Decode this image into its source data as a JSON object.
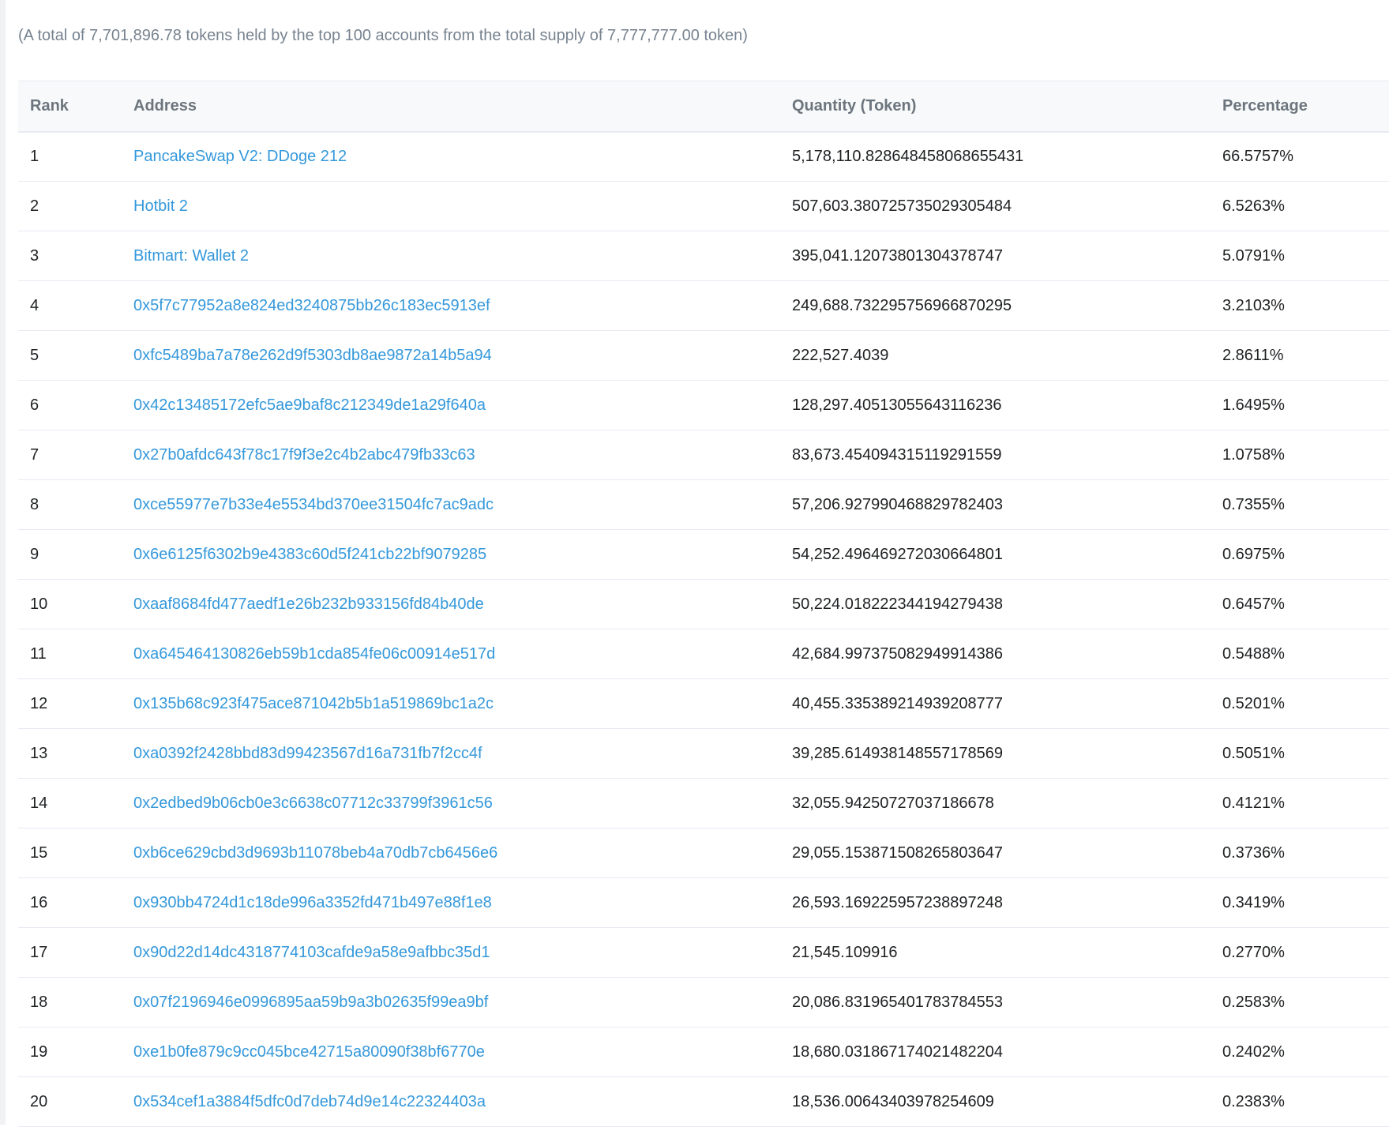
{
  "summary": "(A total of 7,701,896.78 tokens held by the top 100 accounts from the total supply of 7,777,777.00 token)",
  "columns": {
    "rank": "Rank",
    "address": "Address",
    "quantity": "Quantity (Token)",
    "percentage": "Percentage"
  },
  "colors": {
    "link": "#3498db",
    "header_bg": "#f8f9fa",
    "muted_text": "#77838f",
    "border": "#e7eaf3"
  },
  "rows": [
    {
      "rank": "1",
      "address": "PancakeSwap V2: DDoge 212",
      "quantity": "5,178,110.828648458068655431",
      "percentage": "66.5757%"
    },
    {
      "rank": "2",
      "address": "Hotbit 2",
      "quantity": "507,603.380725735029305484",
      "percentage": "6.5263%"
    },
    {
      "rank": "3",
      "address": "Bitmart: Wallet 2",
      "quantity": "395,041.12073801304378747",
      "percentage": "5.0791%"
    },
    {
      "rank": "4",
      "address": "0x5f7c77952a8e824ed3240875bb26c183ec5913ef",
      "quantity": "249,688.732295756966870295",
      "percentage": "3.2103%"
    },
    {
      "rank": "5",
      "address": "0xfc5489ba7a78e262d9f5303db8ae9872a14b5a94",
      "quantity": "222,527.4039",
      "percentage": "2.8611%"
    },
    {
      "rank": "6",
      "address": "0x42c13485172efc5ae9baf8c212349de1a29f640a",
      "quantity": "128,297.40513055643116236",
      "percentage": "1.6495%"
    },
    {
      "rank": "7",
      "address": "0x27b0afdc643f78c17f9f3e2c4b2abc479fb33c63",
      "quantity": "83,673.454094315119291559",
      "percentage": "1.0758%"
    },
    {
      "rank": "8",
      "address": "0xce55977e7b33e4e5534bd370ee31504fc7ac9adc",
      "quantity": "57,206.927990468829782403",
      "percentage": "0.7355%"
    },
    {
      "rank": "9",
      "address": "0x6e6125f6302b9e4383c60d5f241cb22bf9079285",
      "quantity": "54,252.496469272030664801",
      "percentage": "0.6975%"
    },
    {
      "rank": "10",
      "address": "0xaaf8684fd477aedf1e26b232b933156fd84b40de",
      "quantity": "50,224.018222344194279438",
      "percentage": "0.6457%"
    },
    {
      "rank": "11",
      "address": "0xa645464130826eb59b1cda854fe06c00914e517d",
      "quantity": "42,684.997375082949914386",
      "percentage": "0.5488%"
    },
    {
      "rank": "12",
      "address": "0x135b68c923f475ace871042b5b1a519869bc1a2c",
      "quantity": "40,455.335389214939208777",
      "percentage": "0.5201%"
    },
    {
      "rank": "13",
      "address": "0xa0392f2428bbd83d99423567d16a731fb7f2cc4f",
      "quantity": "39,285.614938148557178569",
      "percentage": "0.5051%"
    },
    {
      "rank": "14",
      "address": "0x2edbed9b06cb0e3c6638c07712c33799f3961c56",
      "quantity": "32,055.94250727037186678",
      "percentage": "0.4121%"
    },
    {
      "rank": "15",
      "address": "0xb6ce629cbd3d9693b11078beb4a70db7cb6456e6",
      "quantity": "29,055.153871508265803647",
      "percentage": "0.3736%"
    },
    {
      "rank": "16",
      "address": "0x930bb4724d1c18de996a3352fd471b497e88f1e8",
      "quantity": "26,593.169225957238897248",
      "percentage": "0.3419%"
    },
    {
      "rank": "17",
      "address": "0x90d22d14dc4318774103cafde9a58e9afbbc35d1",
      "quantity": "21,545.109916",
      "percentage": "0.2770%"
    },
    {
      "rank": "18",
      "address": "0x07f2196946e0996895aa59b9a3b02635f99ea9bf",
      "quantity": "20,086.831965401783784553",
      "percentage": "0.2583%"
    },
    {
      "rank": "19",
      "address": "0xe1b0fe879c9cc045bce42715a80090f38bf6770e",
      "quantity": "18,680.031867174021482204",
      "percentage": "0.2402%"
    },
    {
      "rank": "20",
      "address": "0x534cef1a3884f5dfc0d7deb74d9e14c22324403a",
      "quantity": "18,536.00643403978254609",
      "percentage": "0.2383%"
    }
  ]
}
